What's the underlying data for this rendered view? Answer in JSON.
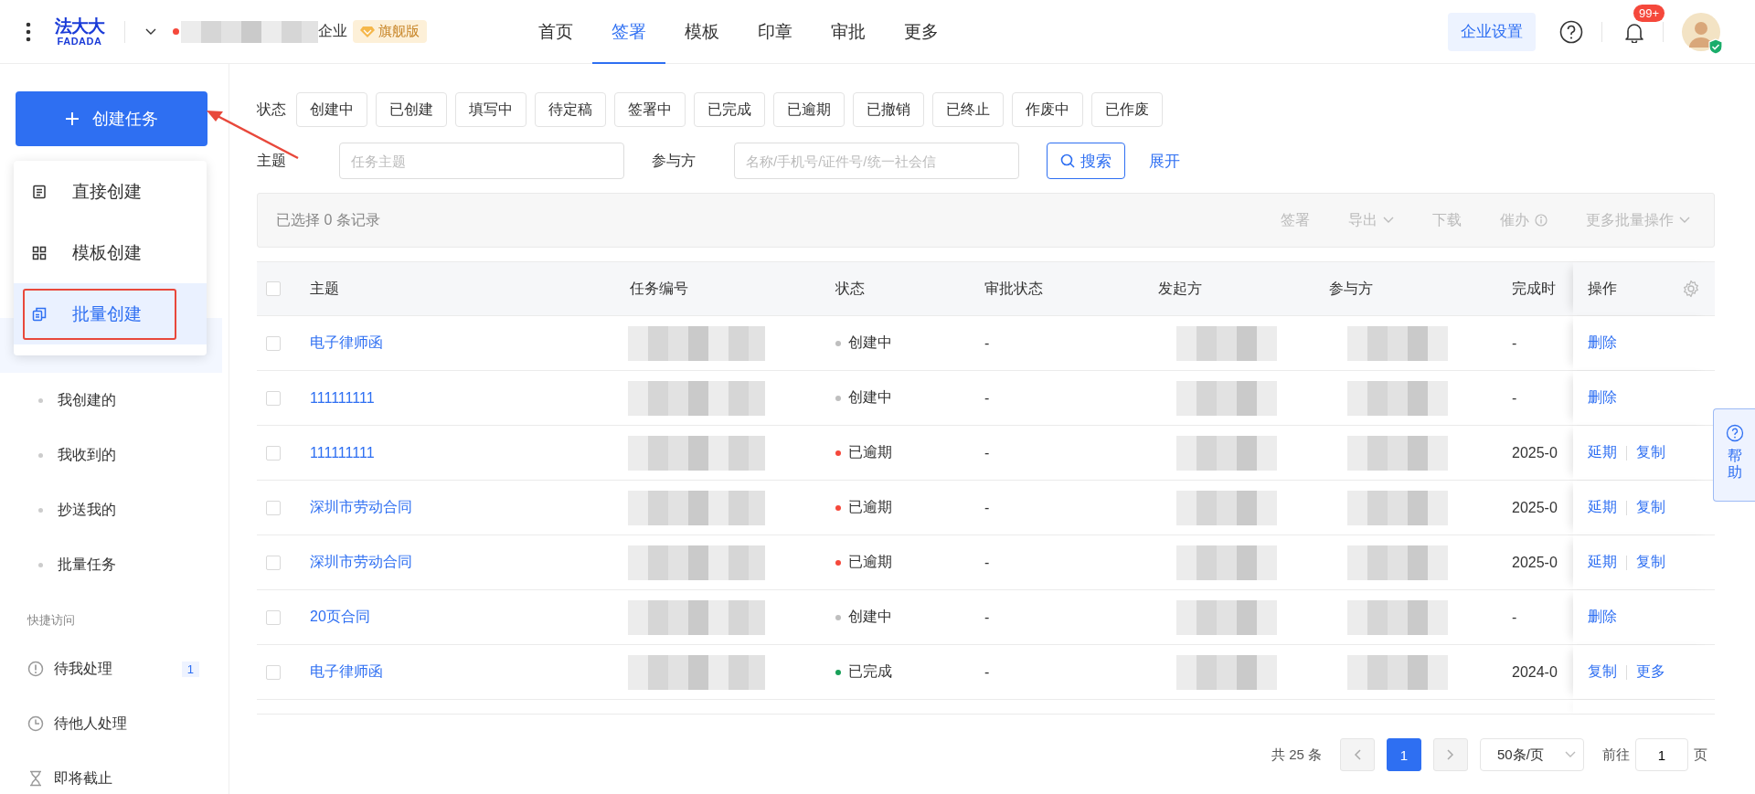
{
  "header": {
    "brand_cn": "法大大",
    "brand_en": "FADADA",
    "company_suffix": "企业",
    "edition_badge": "旗舰版",
    "nav": [
      {
        "label": "首页",
        "selected": false
      },
      {
        "label": "签署",
        "selected": true
      },
      {
        "label": "模板",
        "selected": false
      },
      {
        "label": "印章",
        "selected": false
      },
      {
        "label": "审批",
        "selected": false
      },
      {
        "label": "更多",
        "selected": false
      }
    ],
    "settings_button": "企业设置",
    "notification_count": "99+"
  },
  "sidebar": {
    "create_button": "创建任务",
    "create_menu": [
      {
        "label": "直接创建",
        "kind": "document",
        "selected": false
      },
      {
        "label": "模板创建",
        "kind": "grid",
        "selected": false
      },
      {
        "label": "批量创建",
        "kind": "copies",
        "selected": true
      }
    ],
    "items": [
      {
        "label": "我创建的"
      },
      {
        "label": "我收到的"
      },
      {
        "label": "抄送我的"
      },
      {
        "label": "批量任务"
      }
    ],
    "quick_access_title": "快捷访问",
    "quick_access": [
      {
        "label": "待我处理",
        "kind": "alert",
        "count": "1"
      },
      {
        "label": "待他人处理",
        "kind": "clock"
      },
      {
        "label": "即将截止",
        "kind": "hourglass"
      }
    ]
  },
  "filters": {
    "status_label": "状态",
    "statuses": [
      {
        "label": "创建中",
        "selected": false
      },
      {
        "label": "已创建",
        "selected": false
      },
      {
        "label": "填写中",
        "selected": false
      },
      {
        "label": "待定稿",
        "selected": false
      },
      {
        "label": "签署中",
        "selected": false
      },
      {
        "label": "已完成",
        "selected": false
      },
      {
        "label": "已逾期",
        "selected": false
      },
      {
        "label": "已撤销",
        "selected": false
      },
      {
        "label": "已终止",
        "selected": false
      },
      {
        "label": "作废中",
        "selected": false
      },
      {
        "label": "已作废",
        "selected": false
      }
    ],
    "subject_label": "主题",
    "subject_placeholder": "任务主题",
    "participant_label": "参与方",
    "participant_placeholder": "名称/手机号/证件号/统一社会信",
    "search_button": "搜索",
    "expand_link": "展开"
  },
  "selection_bar": {
    "summary": "已选择 0 条记录",
    "actions": [
      {
        "label": "签署",
        "kind": "plain",
        "disabled": true
      },
      {
        "label": "导出",
        "kind": "dropdown",
        "disabled": true
      },
      {
        "label": "下载",
        "kind": "plain",
        "disabled": true
      },
      {
        "label": "催办",
        "kind": "info",
        "disabled": true
      },
      {
        "label": "更多批量操作",
        "kind": "dropdown",
        "disabled": true
      }
    ]
  },
  "table": {
    "columns": [
      "主题",
      "任务编号",
      "状态",
      "审批状态",
      "发起方",
      "参与方",
      "完成时",
      "操作"
    ],
    "all_checked": false,
    "rows": [
      {
        "checked": false,
        "subject": "电子律师函",
        "status": "创建中",
        "color": "#bfbfbf",
        "approval": "-",
        "completed": "-",
        "actions": [
          "删除"
        ]
      },
      {
        "checked": false,
        "subject": "111111111",
        "status": "创建中",
        "color": "#bfbfbf",
        "approval": "-",
        "completed": "-",
        "actions": [
          "删除"
        ]
      },
      {
        "checked": false,
        "subject": "111111111",
        "status": "已逾期",
        "color": "#f5483b",
        "approval": "-",
        "completed": "2025-0",
        "actions": [
          "延期",
          "复制"
        ]
      },
      {
        "checked": false,
        "subject": "深圳市劳动合同",
        "status": "已逾期",
        "color": "#f5483b",
        "approval": "-",
        "completed": "2025-0",
        "actions": [
          "延期",
          "复制"
        ]
      },
      {
        "checked": false,
        "subject": "深圳市劳动合同",
        "status": "已逾期",
        "color": "#f5483b",
        "approval": "-",
        "completed": "2025-0",
        "actions": [
          "延期",
          "复制"
        ]
      },
      {
        "checked": false,
        "subject": "20页合同",
        "status": "创建中",
        "color": "#bfbfbf",
        "approval": "-",
        "completed": "-",
        "actions": [
          "删除"
        ]
      },
      {
        "checked": false,
        "subject": "电子律师函",
        "status": "已完成",
        "color": "#18a058",
        "approval": "-",
        "completed": "2024-0",
        "actions": [
          "复制",
          "更多"
        ]
      }
    ]
  },
  "pagination": {
    "total": "共 25 条",
    "pages": [
      {
        "label": "1",
        "selected": true
      }
    ],
    "page_size": "50条/页",
    "goto_label": "前往",
    "goto_value": "1",
    "goto_suffix": "页"
  },
  "help_tab": "帮助"
}
